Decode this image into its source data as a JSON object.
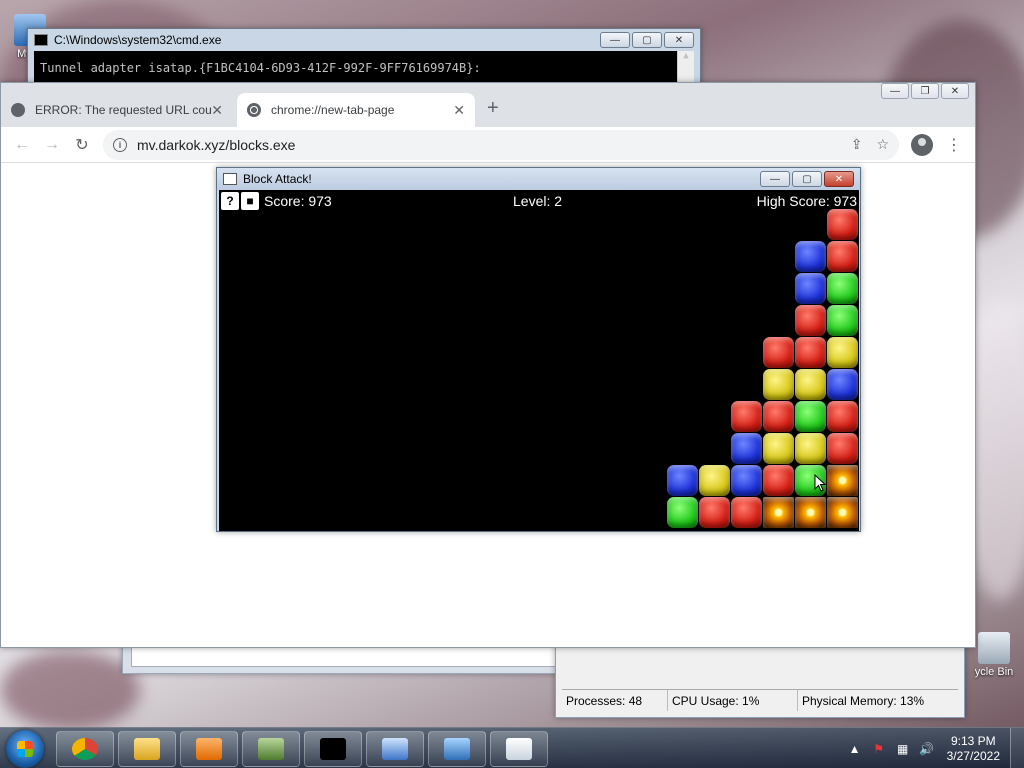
{
  "desktop": {
    "icons": [
      {
        "label": "My C"
      },
      {
        "label": "ycle Bin"
      }
    ]
  },
  "cmd": {
    "title": "C:\\Windows\\system32\\cmd.exe",
    "line": "Tunnel adapter isatap.{F1BC4104-6D93-412F-992F-9FF76169974B}:"
  },
  "chrome": {
    "tabs": [
      {
        "label": "ERROR: The requested URL could",
        "active": false
      },
      {
        "label": "chrome://new-tab-page",
        "active": true
      }
    ],
    "url": "mv.darkok.xyz/blocks.exe",
    "nav": {
      "back": "←",
      "forward": "→",
      "reload": "↻"
    },
    "omni_actions": {
      "share": "⇪",
      "bookmark": "☆"
    },
    "menu": "⋮",
    "newtab": "+"
  },
  "game": {
    "title": "Block Attack!",
    "help_label": "?",
    "stop_label": "■",
    "score_label": "Score: 973",
    "level_label": "Level: 2",
    "highscore_label": "High Score: 973",
    "colors": {
      "red": "#d41e14",
      "blue": "#1c31d8",
      "green": "#1fc919",
      "yellow": "#d6c817"
    },
    "grid": [
      {
        "c": 19,
        "r": 0,
        "t": "red"
      },
      {
        "c": 18,
        "r": 1,
        "t": "blue"
      },
      {
        "c": 19,
        "r": 1,
        "t": "red"
      },
      {
        "c": 18,
        "r": 2,
        "t": "blue"
      },
      {
        "c": 19,
        "r": 2,
        "t": "green"
      },
      {
        "c": 18,
        "r": 3,
        "t": "red"
      },
      {
        "c": 19,
        "r": 3,
        "t": "green"
      },
      {
        "c": 17,
        "r": 4,
        "t": "red"
      },
      {
        "c": 18,
        "r": 4,
        "t": "red"
      },
      {
        "c": 19,
        "r": 4,
        "t": "yellow"
      },
      {
        "c": 17,
        "r": 5,
        "t": "yellow"
      },
      {
        "c": 18,
        "r": 5,
        "t": "yellow"
      },
      {
        "c": 19,
        "r": 5,
        "t": "blue"
      },
      {
        "c": 16,
        "r": 6,
        "t": "red"
      },
      {
        "c": 17,
        "r": 6,
        "t": "red"
      },
      {
        "c": 18,
        "r": 6,
        "t": "green"
      },
      {
        "c": 19,
        "r": 6,
        "t": "red"
      },
      {
        "c": 16,
        "r": 7,
        "t": "blue"
      },
      {
        "c": 17,
        "r": 7,
        "t": "yellow"
      },
      {
        "c": 18,
        "r": 7,
        "t": "yellow"
      },
      {
        "c": 19,
        "r": 7,
        "t": "red"
      },
      {
        "c": 14,
        "r": 8,
        "t": "blue"
      },
      {
        "c": 15,
        "r": 8,
        "t": "yellow"
      },
      {
        "c": 16,
        "r": 8,
        "t": "blue"
      },
      {
        "c": 17,
        "r": 8,
        "t": "red"
      },
      {
        "c": 18,
        "r": 8,
        "t": "green"
      },
      {
        "c": 19,
        "r": 8,
        "t": "bomb"
      },
      {
        "c": 14,
        "r": 9,
        "t": "green"
      },
      {
        "c": 15,
        "r": 9,
        "t": "red"
      },
      {
        "c": 16,
        "r": 9,
        "t": "red"
      },
      {
        "c": 17,
        "r": 9,
        "t": "bomb"
      },
      {
        "c": 18,
        "r": 9,
        "t": "bomb"
      },
      {
        "c": 19,
        "r": 9,
        "t": "bomb"
      }
    ]
  },
  "taskmgr": {
    "processes": "Processes: 48",
    "cpu": "CPU Usage: 1%",
    "memory": "Physical Memory: 13%"
  },
  "taskbar": {
    "apps": [
      {
        "name": "chrome"
      },
      {
        "name": "explorer"
      },
      {
        "name": "media-player"
      },
      {
        "name": "device-manager"
      },
      {
        "name": "cmd"
      },
      {
        "name": "remote-desktop"
      },
      {
        "name": "control-panel"
      },
      {
        "name": "document"
      }
    ],
    "time": "9:13 PM",
    "date": "3/27/2022"
  }
}
